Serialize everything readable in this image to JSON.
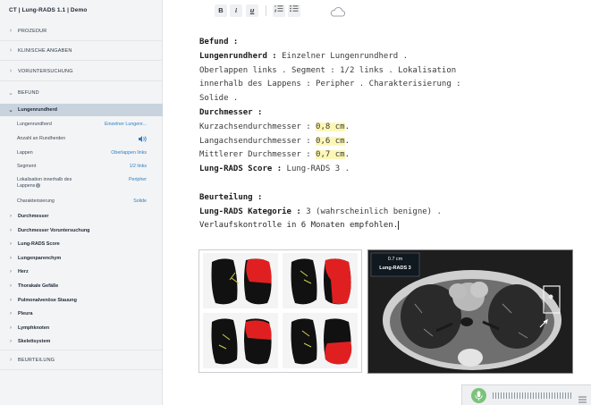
{
  "app_title": "CT | Lung-RADS 1.1 | Demo",
  "sidebar": {
    "sections_top": [
      {
        "label": "PROZEDUR"
      },
      {
        "label": "KLINISCHE ANGABEN"
      },
      {
        "label": "VORUNTERSUCHUNG"
      },
      {
        "label": "BEFUND"
      }
    ],
    "active_sub": "Lungenrundherd",
    "fields": [
      {
        "label": "Lungenrundherd",
        "value": "Einzelner Lungenr..."
      },
      {
        "label": "Anzahl an Rundherden",
        "value": ""
      },
      {
        "label": "Lappen",
        "value": "Oberlappen links"
      },
      {
        "label": "Segment",
        "value": "1/2 links"
      },
      {
        "label": "Lokalisation innerhalb des",
        "label2": "Lappens",
        "value": "Peripher"
      },
      {
        "label": "Charakterisierung",
        "value": "Solide"
      }
    ],
    "subsections": [
      {
        "label": "Durchmesser"
      },
      {
        "label": "Durchmesser Voruntersuchung"
      },
      {
        "label": "Lung-RADS Score"
      },
      {
        "label": "Lungenparenchym"
      },
      {
        "label": "Herz"
      },
      {
        "label": "Thorakale Gefäße"
      },
      {
        "label": "Pulmonalvenöse Stauung"
      },
      {
        "label": "Pleura"
      },
      {
        "label": "Lymphknoten"
      },
      {
        "label": "Skelettsystem"
      }
    ],
    "section_bottom": "BEURTEILUNG"
  },
  "toolbar": {
    "bold": "B",
    "italic": "i",
    "underline": "u",
    "icons": [
      "ordered-list-icon",
      "bullet-list-icon",
      "cloud-icon"
    ]
  },
  "report": {
    "befund_heading": "Befund :",
    "lungenrundherd_label": "Lungenrundherd :",
    "lungenrundherd_value": "Einzelner Lungenrundherd .",
    "line2": "Oberlappen links .  Segment :  1/2 links .  Lokalisation",
    "line3_a": "innerhalb des Lappens :  Peripher .  Charakterisierung :",
    "line4": "Solide .",
    "durchmesser_heading": "Durchmesser :",
    "kurz_label": "Kurzachsendurchmesser :",
    "kurz_value": "0,8 cm",
    "lang_label": "Langachsendurchmesser :",
    "lang_value": "0,6 cm",
    "mittel_label": "Mittlerer Durchmesser :",
    "mittel_value": "0,7 cm",
    "score_label": "Lung-RADS Score :",
    "score_value": "Lung-RADS 3 .",
    "beurteilung_heading": "Beurteilung :",
    "kategorie_label": "Lung-RADS Kategorie :",
    "kategorie_value": "3 (wahrscheinlich benigne) .",
    "verlauf": "Verlaufskontrolle in 6 Monaten empfohlen."
  },
  "ct_overlay": {
    "size": "0.7 cm",
    "category": "Lung-RADS 3"
  },
  "colors": {
    "accent_blue": "#2d7fc1",
    "active_row": "#c8d3de",
    "highlight": "#fdf7b7",
    "mic_green": "#7dc27b",
    "lung_red": "#e02020"
  }
}
